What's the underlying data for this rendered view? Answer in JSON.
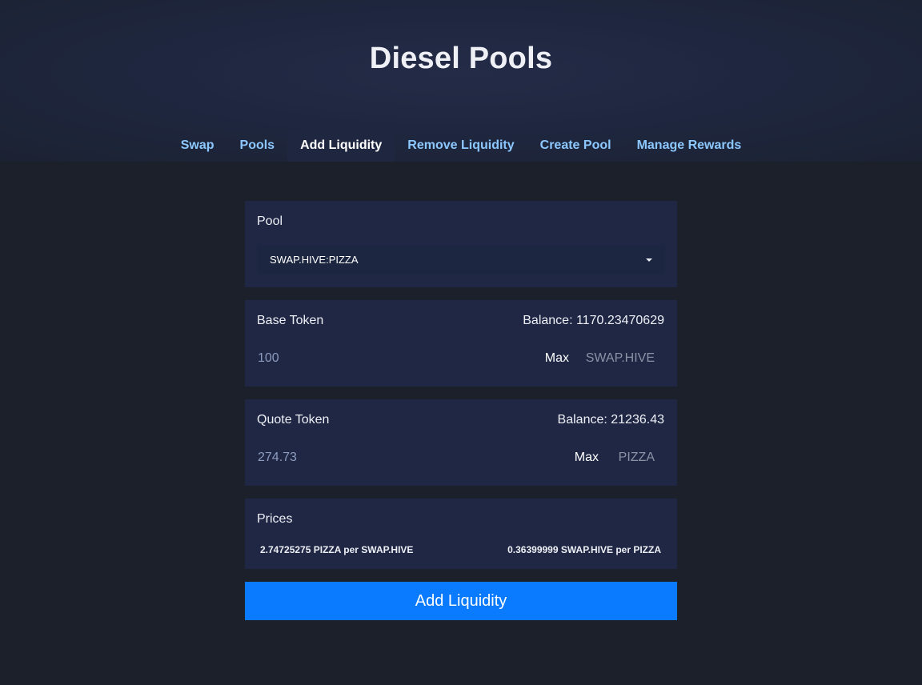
{
  "app": {
    "title": "Diesel Pools"
  },
  "nav": {
    "tabs": [
      {
        "label": "Swap"
      },
      {
        "label": "Pools"
      },
      {
        "label": "Add Liquidity"
      },
      {
        "label": "Remove Liquidity"
      },
      {
        "label": "Create Pool"
      },
      {
        "label": "Manage Rewards"
      }
    ],
    "active": "Add Liquidity"
  },
  "pool": {
    "label": "Pool",
    "selected": "SWAP.HIVE:PIZZA"
  },
  "base": {
    "label": "Base Token",
    "balance": "Balance: 1170.23470629",
    "amount": "100",
    "max_label": "Max",
    "symbol": "SWAP.HIVE"
  },
  "quote": {
    "label": "Quote Token",
    "balance": "Balance: 21236.43",
    "amount": "274.73",
    "max_label": "Max",
    "symbol": "PIZZA"
  },
  "prices": {
    "label": "Prices",
    "base_to_quote": "2.74725275 PIZZA per SWAP.HIVE",
    "quote_to_base": "0.36399999 SWAP.HIVE per PIZZA"
  },
  "submit_label": "Add Liquidity",
  "colors": {
    "page_bg": "#1b202b",
    "card_bg": "#1f2744",
    "link": "#8cc8ff",
    "primary_button": "#0a7bff"
  }
}
